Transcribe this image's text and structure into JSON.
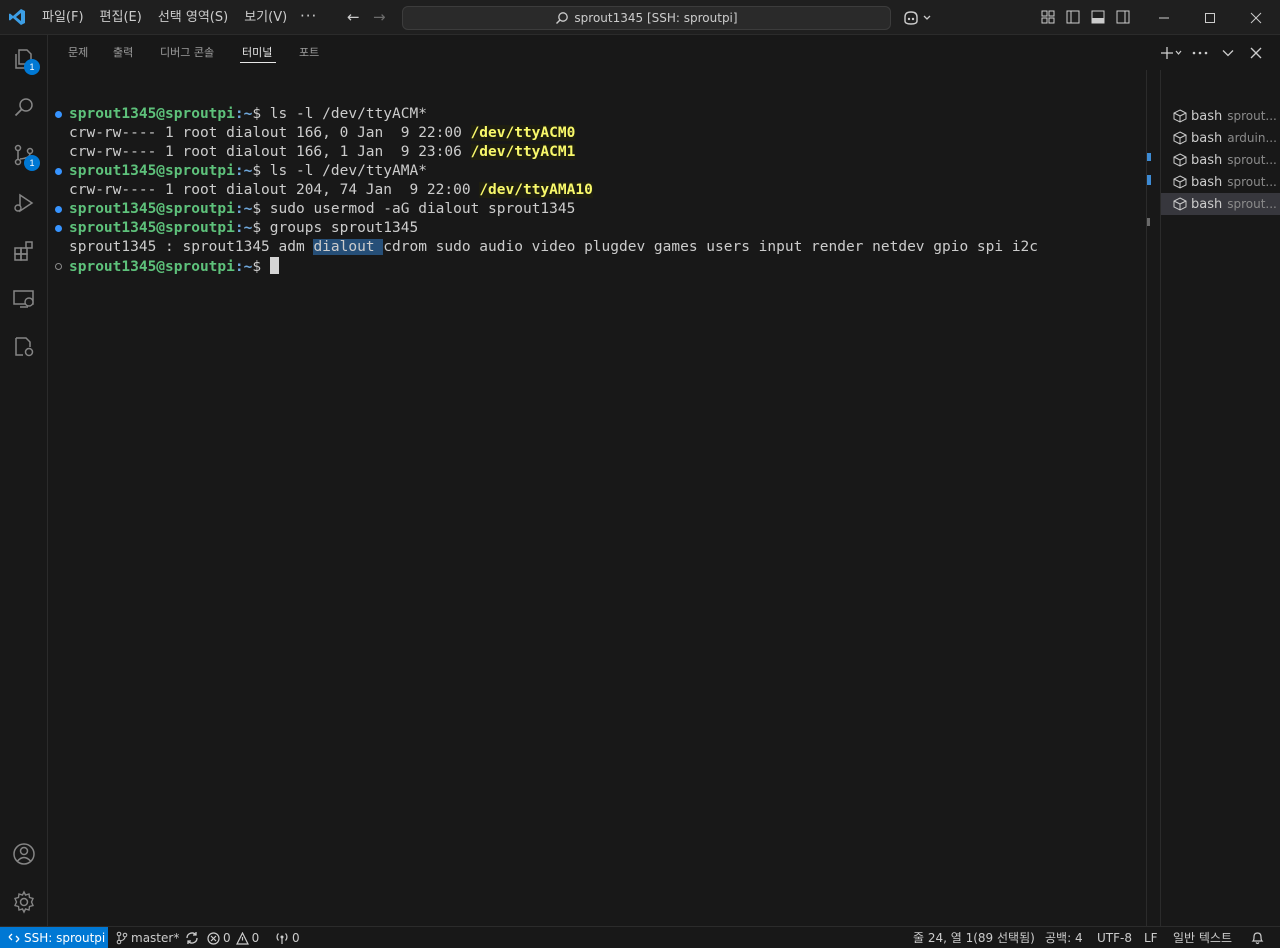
{
  "titlebar": {
    "menu": [
      "파일(F)",
      "편집(E)",
      "선택 영역(S)",
      "보기(V)"
    ],
    "more": "···",
    "back_arrow": "←",
    "forward_arrow": "→",
    "search_text": "sprout1345 [SSH: sproutpi]"
  },
  "activity": {
    "explorer_badge": "1",
    "scm_badge": "1"
  },
  "panel": {
    "tabs": [
      "문제",
      "출력",
      "디버그 콘솔",
      "터미널",
      "포트"
    ],
    "active_tab": "터미널"
  },
  "terminal": {
    "user_host": "sprout1345@sproutpi",
    "path": ":~",
    "lines": {
      "l1_cmd": "$ ls -l /dev/ttyACM*",
      "l2_pre": "crw-rw---- 1 root dialout 166, 0 Jan  9 22:00 ",
      "l2_dev": "/dev/ttyACM0",
      "l3_pre": "crw-rw---- 1 root dialout 166, 1 Jan  9 23:06 ",
      "l3_dev": "/dev/ttyACM1",
      "l4_cmd": "$ ls -l /dev/ttyAMA*",
      "l5_pre": "crw-rw---- 1 root dialout 204, 74 Jan  9 22:00 ",
      "l5_dev": "/dev/ttyAMA10",
      "l6_cmd": "$ sudo usermod -aG dialout sprout1345",
      "l7_cmd": "$ groups sprout1345",
      "l8_pre": "sprout1345 : sprout1345 adm ",
      "l8_sel": "dialout ",
      "l8_post": "cdrom sudo audio video plugdev games users input render netdev gpio spi i2c",
      "l9_cmd": "$ "
    }
  },
  "terminal_tabs": [
    {
      "name": "bash",
      "desc": "sprout..."
    },
    {
      "name": "bash",
      "desc": "arduin..."
    },
    {
      "name": "bash",
      "desc": "sprout..."
    },
    {
      "name": "bash",
      "desc": "sprout..."
    },
    {
      "name": "bash",
      "desc": "sprout..."
    }
  ],
  "statusbar": {
    "remote": "SSH: sproutpi",
    "branch": "master*",
    "errors": "0",
    "warnings": "0",
    "ports": "0",
    "position": "줄 24, 열 1(89 선택됨)",
    "spaces": "공백: 4",
    "encoding": "UTF-8",
    "eol": "LF",
    "language": "일반 텍스트"
  },
  "colors": {
    "accent": "#0078d4",
    "prompt_green": "#5ec27b",
    "device_yellow": "#f8f86a",
    "selection": "#264f78"
  }
}
